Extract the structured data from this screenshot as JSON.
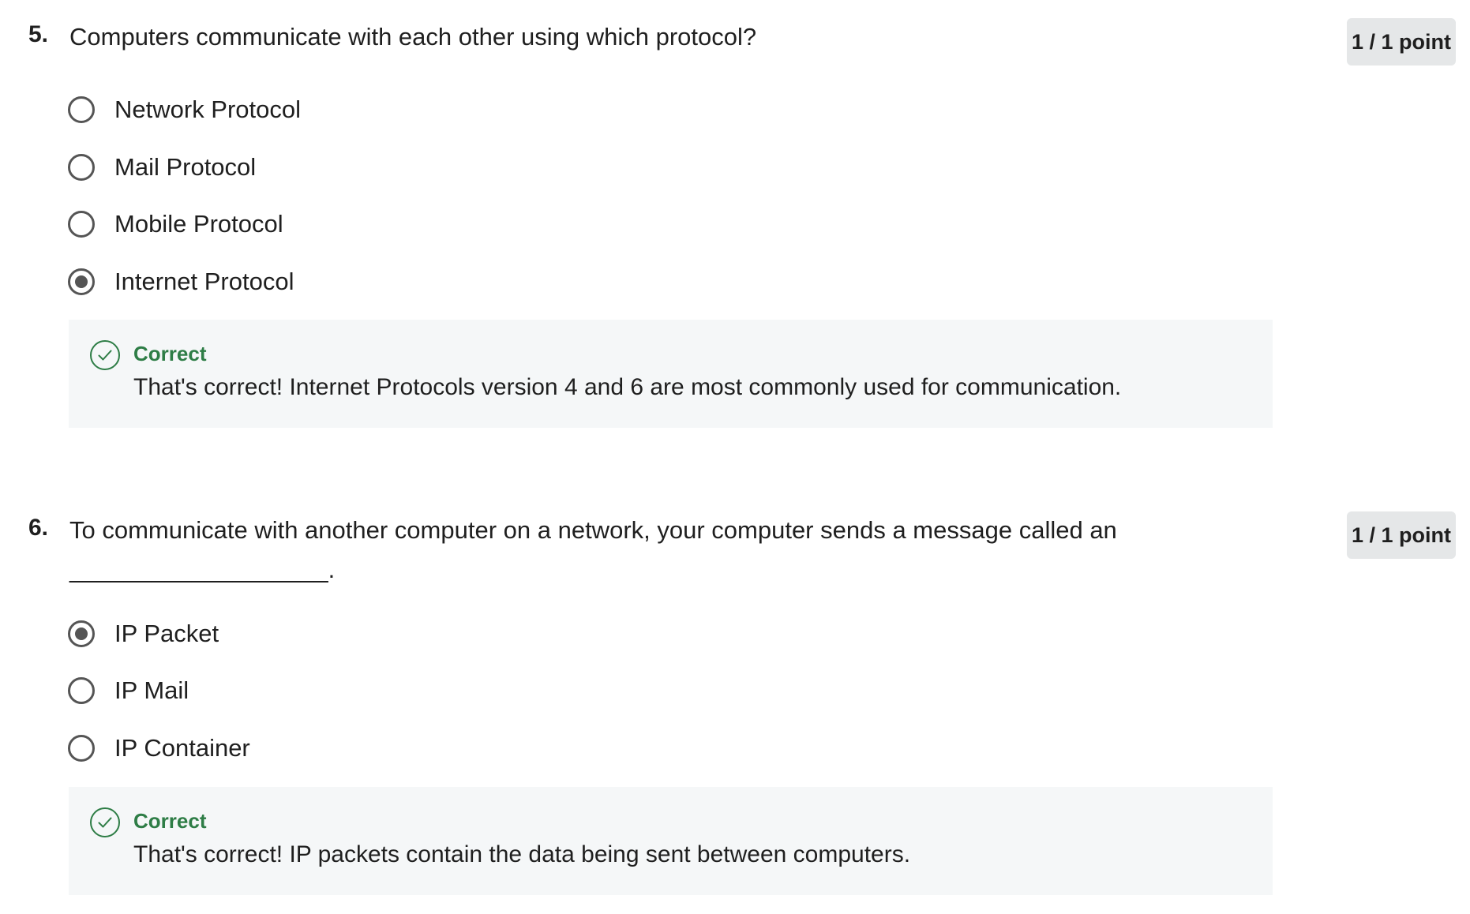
{
  "questions": [
    {
      "number": "5.",
      "text": "Computers communicate with each other using which protocol?",
      "points": "1 / 1 point",
      "options": [
        {
          "label": "Network Protocol",
          "selected": false
        },
        {
          "label": "Mail Protocol",
          "selected": false
        },
        {
          "label": "Mobile Protocol",
          "selected": false
        },
        {
          "label": "Internet Protocol",
          "selected": true
        }
      ],
      "feedback": {
        "status": "Correct",
        "message": "That's correct! Internet Protocols version 4 and 6 are most commonly used for communication.",
        "icon": "check-circle-icon"
      }
    },
    {
      "number": "6.",
      "text": "To communicate with another computer on a network, your computer sends a message called an ___________________.",
      "points": "1 / 1 point",
      "options": [
        {
          "label": "IP Packet",
          "selected": true
        },
        {
          "label": "IP Mail",
          "selected": false
        },
        {
          "label": "IP Container",
          "selected": false
        }
      ],
      "feedback": {
        "status": "Correct",
        "message": "That's correct! IP packets contain the data being sent between computers.",
        "icon": "check-circle-icon"
      }
    }
  ],
  "colors": {
    "correct": "#2e7d46",
    "feedback_bg": "#f5f7f8",
    "points_bg": "#e5e7e8",
    "radio": "#555555"
  }
}
